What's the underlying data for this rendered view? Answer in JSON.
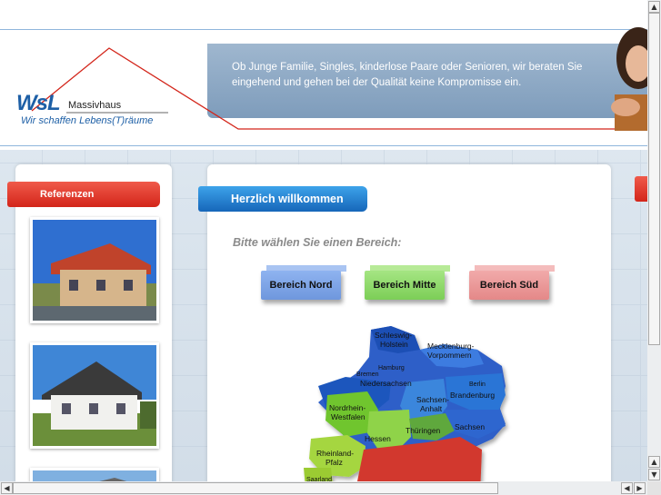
{
  "header": {
    "tagline": "Ob Junge Familie, Singles, kinderlose Paare oder Senioren, wir beraten Sie eingehend und gehen bei der Qualität keine Kompromisse ein.",
    "logo": {
      "wsl": "WsL",
      "massivhaus": "Massivhaus",
      "slogan": "Wir schaffen Lebens(T)räume"
    }
  },
  "sidebar": {
    "tab_label": "Referenzen"
  },
  "main": {
    "tab_label": "Herzlich willkommen",
    "choose_text": "Bitte wählen Sie einen Bereich:",
    "regions": [
      {
        "label": "Bereich Nord",
        "color": "#7fa6e8"
      },
      {
        "label": "Bereich Mitte",
        "color": "#8fdc6b"
      },
      {
        "label": "Bereich Süd",
        "color": "#ee9a9a"
      }
    ],
    "map_labels": {
      "sh": "Schleswig-\nHolstein",
      "mv": "Mecklenburg-\nVorpommern",
      "hh": "Hamburg",
      "hb": "Bremen",
      "ni": "Niedersachsen",
      "be": "Berlin",
      "bb": "Brandenburg",
      "st": "Sachsen-\nAnhalt",
      "nw": "Nordrhein-\nWestfalen",
      "sn": "Sachsen",
      "he": "Hessen",
      "th": "Thüringen",
      "rp": "Rheinland-\nPfalz",
      "sl": "Saarland"
    }
  },
  "colors": {
    "accent_red": "#d3251a",
    "accent_blue": "#1666b9"
  }
}
